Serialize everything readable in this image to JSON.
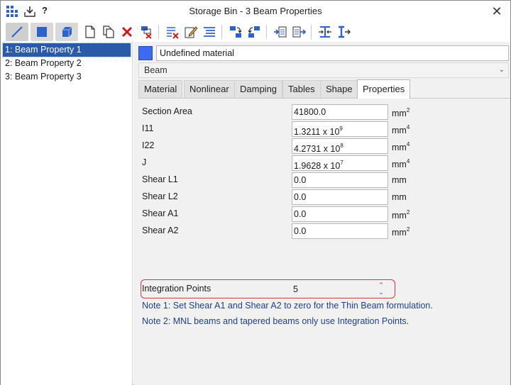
{
  "window": {
    "title": "Storage Bin - 3 Beam Properties",
    "help_label": "?",
    "close_label": "✕"
  },
  "list": {
    "items": [
      "1: Beam Property 1",
      "2: Beam Property 2",
      "3: Beam Property 3"
    ],
    "selected_index": 0
  },
  "material": {
    "name": "Undefined material",
    "swatch_color": "#3d6bf0"
  },
  "element_type": {
    "selected": "Beam"
  },
  "tabs": [
    "Material",
    "Nonlinear",
    "Damping",
    "Tables",
    "Shape",
    "Properties"
  ],
  "active_tab": "Properties",
  "properties": {
    "section_area": {
      "label": "Section Area",
      "value": "41800.0",
      "unit": "mm",
      "unit_exp": "2"
    },
    "i11": {
      "label": "I11",
      "mantissa": "1.3211 x 10",
      "exp": "9",
      "unit": "mm",
      "unit_exp": "4"
    },
    "i22": {
      "label": "I22",
      "mantissa": "4.2731 x 10",
      "exp": "8",
      "unit": "mm",
      "unit_exp": "4"
    },
    "j": {
      "label": "J",
      "mantissa": "1.9628 x 10",
      "exp": "7",
      "unit": "mm",
      "unit_exp": "4"
    },
    "shear_l1": {
      "label": "Shear L1",
      "value": "0.0",
      "unit": "mm"
    },
    "shear_l2": {
      "label": "Shear L2",
      "value": "0.0",
      "unit": "mm"
    },
    "shear_a1": {
      "label": "Shear A1",
      "value": "0.0",
      "unit": "mm",
      "unit_exp": "2"
    },
    "shear_a2": {
      "label": "Shear A2",
      "value": "0.0",
      "unit": "mm",
      "unit_exp": "2"
    },
    "integration_points": {
      "label": "Integration Points",
      "value": "5"
    }
  },
  "notes": [
    "Note 1: Set Shear A1 and Shear A2 to zero for the Thin Beam formulation.",
    "Note 2: MNL beams and tapered beams only use Integration Points."
  ],
  "spinner": {
    "up": "⌃",
    "down": "⌄"
  },
  "colors": {
    "selection": "#2a5aa8",
    "highlight_border": "#d8363a",
    "note_text": "#1f3f8a"
  }
}
